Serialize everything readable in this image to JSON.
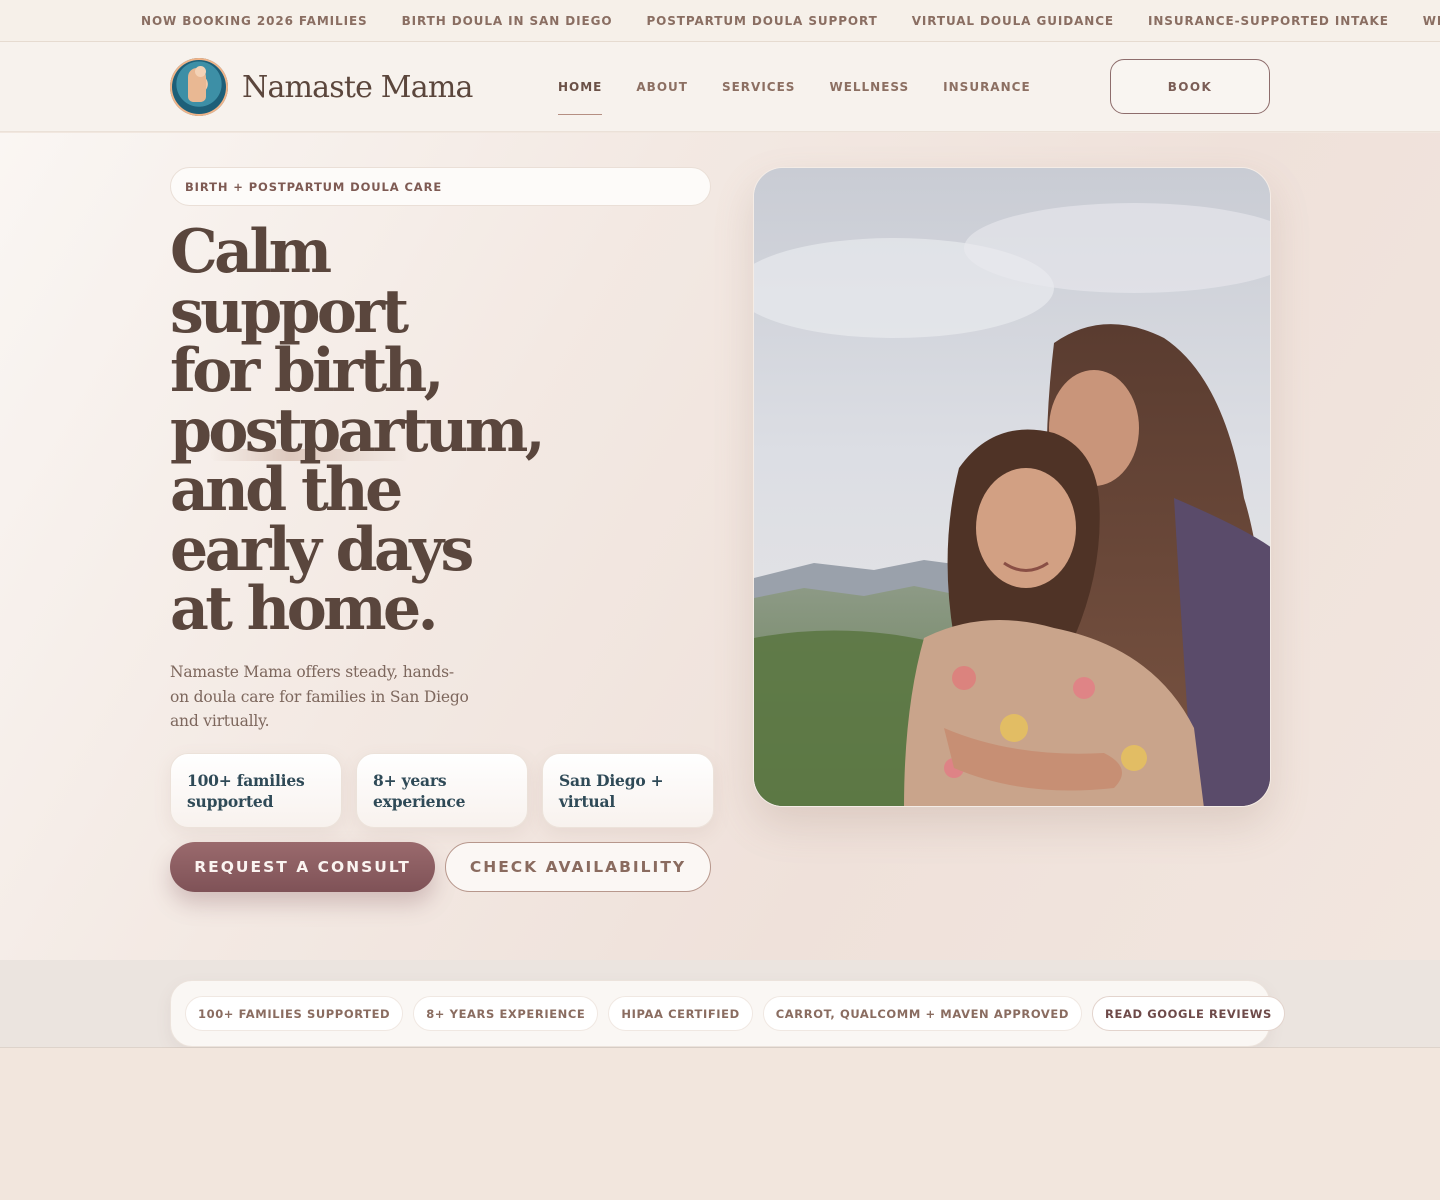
{
  "ticker": [
    "NOW BOOKING 2026 FAMILIES",
    "BIRTH DOULA IN SAN DIEGO",
    "POSTPARTUM DOULA SUPPORT",
    "VIRTUAL DOULA GUIDANCE",
    "INSURANCE-SUPPORTED INTAKE",
    "WELLNESS"
  ],
  "brand": {
    "name": "Namaste Mama"
  },
  "nav": {
    "items": [
      "HOME",
      "ABOUT",
      "SERVICES",
      "WELLNESS",
      "INSURANCE"
    ],
    "active": "HOME",
    "book_label": "BOOK"
  },
  "hero": {
    "badge": "BIRTH + POSTPARTUM DOULA CARE",
    "headline": [
      "Calm",
      "support",
      "for birth,",
      "postpartum,",
      "and the",
      "early days",
      "at home."
    ],
    "lead": "Namaste Mama offers steady, hands-on doula care for families in San Diego and virtually.",
    "stats": [
      "100+ families supported",
      "8+ years experience",
      "San Diego + virtual"
    ],
    "primary_cta": "REQUEST A CONSULT",
    "secondary_cta": "CHECK AVAILABILITY"
  },
  "trust": {
    "items": [
      "100+ FAMILIES SUPPORTED",
      "8+ YEARS EXPERIENCE",
      "HIPAA CERTIFIED",
      "CARROT, QUALCOMM + MAVEN APPROVED"
    ],
    "reviews_link": "READ GOOGLE REVIEWS"
  },
  "colors": {
    "accent": "#8b5e63",
    "text": "#5a463d",
    "stat_text": "#2f4a57",
    "background": "#f1e7df"
  }
}
